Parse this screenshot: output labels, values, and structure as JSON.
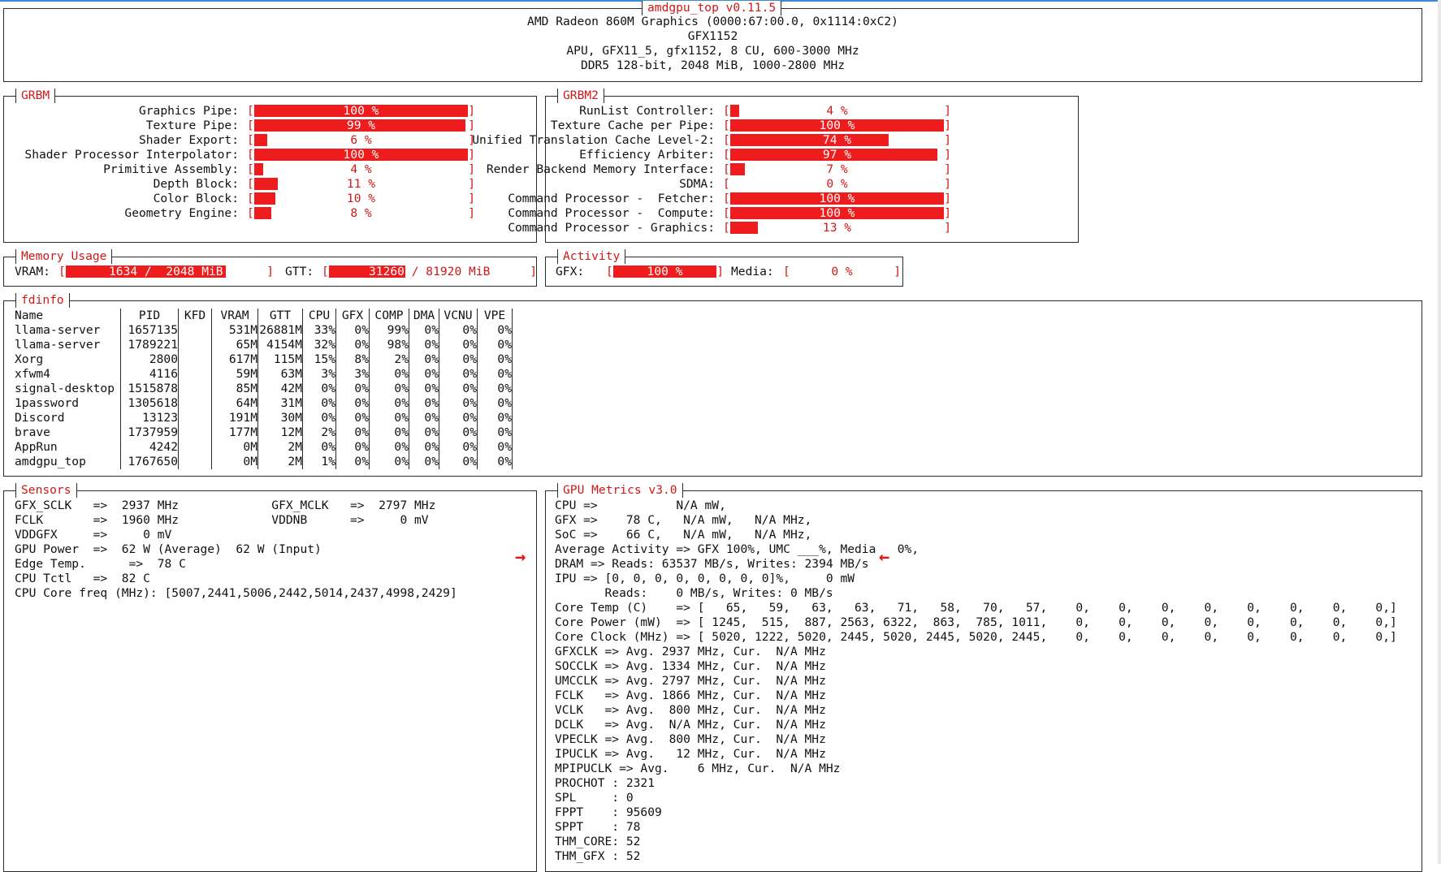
{
  "header": {
    "title": "amdgpu_top v0.11.5",
    "lines": [
      "AMD Radeon 860M Graphics (0000:67:00.0, 0x1114:0xC2)",
      "GFX1152",
      "APU, GFX11_5, gfx1152, 8 CU, 600-3000 MHz",
      "DDR5 128-bit, 2048 MiB, 1000-2800 MHz"
    ]
  },
  "grbm": {
    "title": "GRBM",
    "items": [
      {
        "label": "Graphics Pipe:",
        "value": 100,
        "text": "100 %"
      },
      {
        "label": "Texture Pipe:",
        "value": 99,
        "text": "99 %"
      },
      {
        "label": "Shader Export:",
        "value": 6,
        "text": "6 %"
      },
      {
        "label": "Shader Processor Interpolator:",
        "value": 100,
        "text": "100 %"
      },
      {
        "label": "Primitive Assembly:",
        "value": 4,
        "text": "4 %"
      },
      {
        "label": "Depth Block:",
        "value": 11,
        "text": "11 %"
      },
      {
        "label": "Color Block:",
        "value": 10,
        "text": "10 %"
      },
      {
        "label": "Geometry Engine:",
        "value": 8,
        "text": "8 %"
      }
    ]
  },
  "grbm2": {
    "title": "GRBM2",
    "items": [
      {
        "label": "RunList Controller:",
        "value": 4,
        "text": "4 %"
      },
      {
        "label": "Texture Cache per Pipe:",
        "value": 100,
        "text": "100 %"
      },
      {
        "label": "Unified Translation Cache Level-2:",
        "value": 74,
        "text": "74 %"
      },
      {
        "label": "Efficiency Arbiter:",
        "value": 97,
        "text": "97 %"
      },
      {
        "label": "Render Backend Memory Interface:",
        "value": 7,
        "text": "7 %"
      },
      {
        "label": "SDMA:",
        "value": 0,
        "text": "0 %"
      },
      {
        "label": "Command Processor -  Fetcher:",
        "value": 100,
        "text": "100 %"
      },
      {
        "label": "Command Processor -  Compute:",
        "value": 100,
        "text": "100 %"
      },
      {
        "label": "Command Processor - Graphics:",
        "value": 13,
        "text": "13 %"
      }
    ]
  },
  "memory": {
    "title": "Memory Usage",
    "vram_label": "VRAM:",
    "vram_text": "1634 /  2048 MiB",
    "vram_used": 1634,
    "vram_total": 2048,
    "gtt_label": "GTT:",
    "gtt_text": "31260 / 81920 MiB",
    "gtt_used": 31260,
    "gtt_total": 81920
  },
  "activity": {
    "title": "Activity",
    "gfx_label": "GFX:",
    "gfx_text": "100 %",
    "gfx_value": 100,
    "media_label": "Media:",
    "media_text": "0 %",
    "media_value": 0
  },
  "fdinfo": {
    "title": "fdinfo",
    "columns": [
      "Name",
      "PID",
      "KFD",
      "VRAM",
      "GTT",
      "CPU",
      "GFX",
      "COMP",
      "DMA",
      "VCNU",
      "VPE"
    ],
    "rows": [
      [
        "llama-server",
        "1657135",
        "",
        "531M",
        "26881M",
        "33%",
        "0%",
        "99%",
        "0%",
        "0%",
        "0%"
      ],
      [
        "llama-server",
        "1789221",
        "",
        "65M",
        "4154M",
        "32%",
        "0%",
        "98%",
        "0%",
        "0%",
        "0%"
      ],
      [
        "Xorg",
        "2800",
        "",
        "617M",
        "115M",
        "15%",
        "8%",
        "2%",
        "0%",
        "0%",
        "0%"
      ],
      [
        "xfwm4",
        "4116",
        "",
        "59M",
        "63M",
        "3%",
        "3%",
        "0%",
        "0%",
        "0%",
        "0%"
      ],
      [
        "signal-desktop",
        "1515878",
        "",
        "85M",
        "42M",
        "0%",
        "0%",
        "0%",
        "0%",
        "0%",
        "0%"
      ],
      [
        "1password",
        "1305618",
        "",
        "64M",
        "31M",
        "0%",
        "0%",
        "0%",
        "0%",
        "0%",
        "0%"
      ],
      [
        "Discord",
        "13123",
        "",
        "191M",
        "30M",
        "0%",
        "0%",
        "0%",
        "0%",
        "0%",
        "0%"
      ],
      [
        "brave",
        "1737959",
        "",
        "177M",
        "12M",
        "2%",
        "0%",
        "0%",
        "0%",
        "0%",
        "0%"
      ],
      [
        "AppRun",
        "4242",
        "",
        "0M",
        "2M",
        "0%",
        "0%",
        "0%",
        "0%",
        "0%",
        "0%"
      ],
      [
        "amdgpu_top",
        "1767650",
        "",
        "0M",
        "2M",
        "1%",
        "0%",
        "0%",
        "0%",
        "0%",
        "0%"
      ]
    ]
  },
  "sensors": {
    "title": "Sensors",
    "lines": [
      "GFX_SCLK   =>  2937 MHz             GFX_MCLK   =>  2797 MHz",
      "FCLK       =>  1960 MHz             VDDNB      =>     0 mV",
      "VDDGFX     =>     0 mV",
      "GPU Power  =>  62 W (Average)  62 W (Input)",
      "Edge Temp.      =>  78 C",
      "CPU Tctl   =>  82 C",
      "CPU Core freq (MHz): [5007,2441,5006,2442,5014,2437,4998,2429]"
    ]
  },
  "gpu_metrics": {
    "title": "GPU Metrics v3.0",
    "lines": [
      "CPU =>           N/A mW,",
      "GFX =>    78 C,   N/A mW,   N/A MHz,",
      "SoC =>    66 C,   N/A mW,   N/A MHz,",
      "Average Activity => GFX 100%, UMC ___%, Media   0%,",
      "DRAM => Reads: 63537 MB/s, Writes: 2394 MB/s",
      "IPU => [0, 0, 0, 0, 0, 0, 0, 0]%,     0 mW",
      "       Reads:    0 MB/s, Writes: 0 MB/s",
      "Core Temp (C)    => [   65,   59,   63,   63,   71,   58,   70,   57,    0,    0,    0,    0,    0,    0,    0,    0,]",
      "Core Power (mW)  => [ 1245,  515,  887, 2563, 6322,  863,  785, 1011,    0,    0,    0,    0,    0,    0,    0,    0,]",
      "Core Clock (MHz) => [ 5020, 1222, 5020, 2445, 5020, 2445, 5020, 2445,    0,    0,    0,    0,    0,    0,    0,    0,]",
      "GFXCLK => Avg. 2937 MHz, Cur.  N/A MHz",
      "SOCCLK => Avg. 1334 MHz, Cur.  N/A MHz",
      "UMCCLK => Avg. 2797 MHz, Cur.  N/A MHz",
      "FCLK   => Avg. 1866 MHz, Cur.  N/A MHz",
      "VCLK   => Avg.  800 MHz, Cur.  N/A MHz",
      "DCLK   => Avg.  N/A MHz, Cur.  N/A MHz",
      "VPECLK => Avg.  800 MHz, Cur.  N/A MHz",
      "IPUCLK => Avg.   12 MHz, Cur.  N/A MHz",
      "MPIPUCLK => Avg.    6 MHz, Cur.  N/A MHz",
      "PROCHOT : 2321",
      "SPL     : 0",
      "FPPT    : 95609",
      "SPPT    : 78",
      "THM_CORE: 52",
      "THM_GFX : 52"
    ]
  },
  "annotations": {
    "left_arrow": "→",
    "right_arrow": "←"
  },
  "colors": {
    "accent": "#d01818",
    "bar_fill": "#ee1c1c",
    "border": "#2a2a2a"
  }
}
